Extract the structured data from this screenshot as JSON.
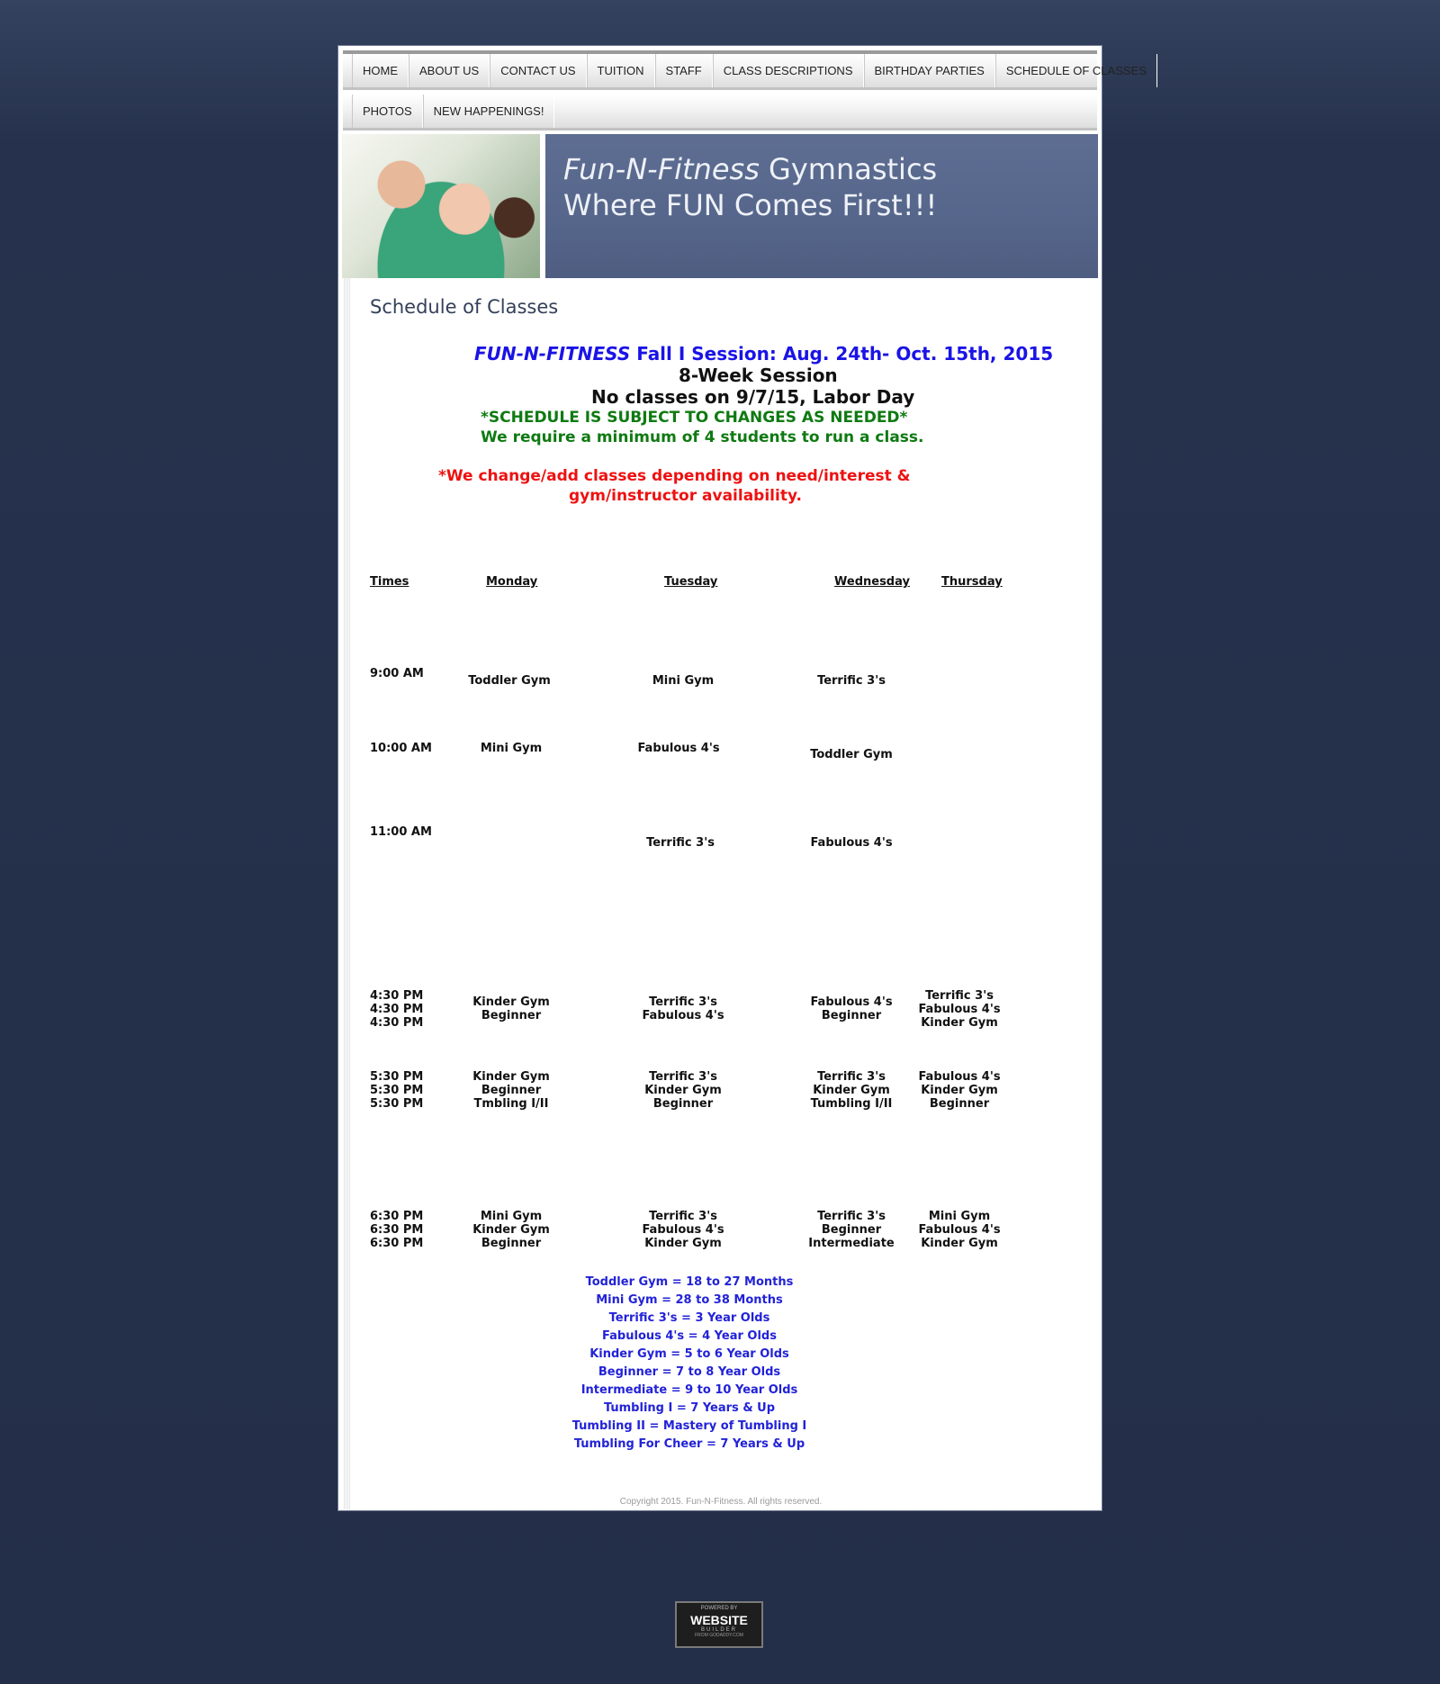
{
  "nav": {
    "row1": [
      "HOME",
      "ABOUT US",
      "CONTACT US",
      "TUITION",
      "STAFF",
      "CLASS DESCRIPTIONS",
      "BIRTHDAY PARTIES",
      "SCHEDULE OF CLASSES"
    ],
    "row2": [
      "PHOTOS",
      "NEW HAPPENINGS!"
    ]
  },
  "banner": {
    "brand": "Fun-N-Fitness",
    "line1_rest": " Gymnastics",
    "line2": "Where FUN Comes First!!!"
  },
  "page_title": "Schedule of Classes",
  "session": {
    "brand": "FUN-N-FITNESS",
    "session_rest": " Fall I Session:  Aug. 24th- Oct. 15th, 2015",
    "weeks": "8-Week Session",
    "no_classes": "No classes on 9/7/15, Labor Day",
    "subject_change": "*SCHEDULE IS SUBJECT TO CHANGES AS NEEDED*",
    "minimum": "We require a minimum of 4 students to run a class.",
    "change_add_1": "*We change/add classes depending on need/interest &",
    "change_add_2": "gym/instructor availability."
  },
  "schedule": {
    "headers": [
      "Times",
      "Monday",
      "Tuesday",
      "Wednesday",
      "Thursday"
    ],
    "rows": [
      {
        "times": [
          "9:00 AM"
        ],
        "mon": [
          "Toddler Gym"
        ],
        "tue": [
          "Mini Gym"
        ],
        "wed": [
          "Terrific 3's"
        ],
        "thu": []
      },
      {
        "times": [
          "10:00 AM"
        ],
        "mon": [
          "Mini Gym"
        ],
        "tue": [
          "Fabulous 4's"
        ],
        "wed": [
          "Toddler Gym"
        ],
        "thu": []
      },
      {
        "times": [
          "11:00 AM"
        ],
        "mon": [],
        "tue": [
          "Terrific 3's"
        ],
        "wed": [
          "Fabulous 4's"
        ],
        "thu": []
      },
      {
        "times": [
          "4:30 PM",
          "4:30 PM",
          "4:30 PM"
        ],
        "mon": [
          "Kinder Gym",
          "Beginner"
        ],
        "tue": [
          "Terrific 3's",
          "Fabulous 4's"
        ],
        "wed": [
          "Fabulous 4's",
          "Beginner"
        ],
        "thu": [
          "Terrific 3's",
          "Fabulous 4's",
          "Kinder Gym"
        ]
      },
      {
        "times": [
          "5:30 PM",
          "5:30 PM",
          "5:30 PM"
        ],
        "mon": [
          "Kinder Gym",
          "Beginner",
          "Tmbling I/II"
        ],
        "tue": [
          "Terrific 3's",
          "Kinder Gym",
          "Beginner"
        ],
        "wed": [
          "Terrific 3's",
          "Kinder Gym",
          "Tumbling I/II"
        ],
        "thu": [
          "Fabulous 4's",
          "Kinder Gym",
          "Beginner"
        ]
      },
      {
        "times": [
          "6:30 PM",
          "6:30 PM",
          "6:30 PM"
        ],
        "mon": [
          "Mini Gym",
          "Kinder Gym",
          "Beginner"
        ],
        "tue": [
          "Terrific 3's",
          "Fabulous 4's",
          "Kinder Gym"
        ],
        "wed": [
          "Terrific 3's",
          "Beginner",
          "Intermediate"
        ],
        "thu": [
          "Mini Gym",
          "Fabulous 4's",
          "Kinder Gym"
        ]
      }
    ]
  },
  "legend": [
    "Toddler Gym = 18 to 27 Months",
    "Mini  Gym = 28 to 38 Months",
    "Terrific 3's = 3 Year Olds",
    "Fabulous 4's = 4 Year Olds",
    "Kinder Gym = 5 to 6 Year Olds",
    "Beginner = 7 to 8 Year Olds",
    "Intermediate = 9 to 10 Year Olds",
    "Tumbling I = 7 Years & Up",
    "Tumbling II = Mastery of Tumbling I",
    "Tumbling For Cheer = 7 Years & Up"
  ],
  "copyright": "Copyright 2015. Fun-N-Fitness. All rights reserved.",
  "badge": {
    "powered": "POWERED BY",
    "website": "WEBSITE",
    "builder": "BUILDER",
    "domain": "FROM GODADDY.COM"
  },
  "colors": {
    "background": "#26324d",
    "banner": "#5a6a8f",
    "session_blue": "#1a13e6",
    "notice_green": "#0f7a12",
    "notice_red": "#ee1111",
    "legend_blue": "#2222d8"
  }
}
